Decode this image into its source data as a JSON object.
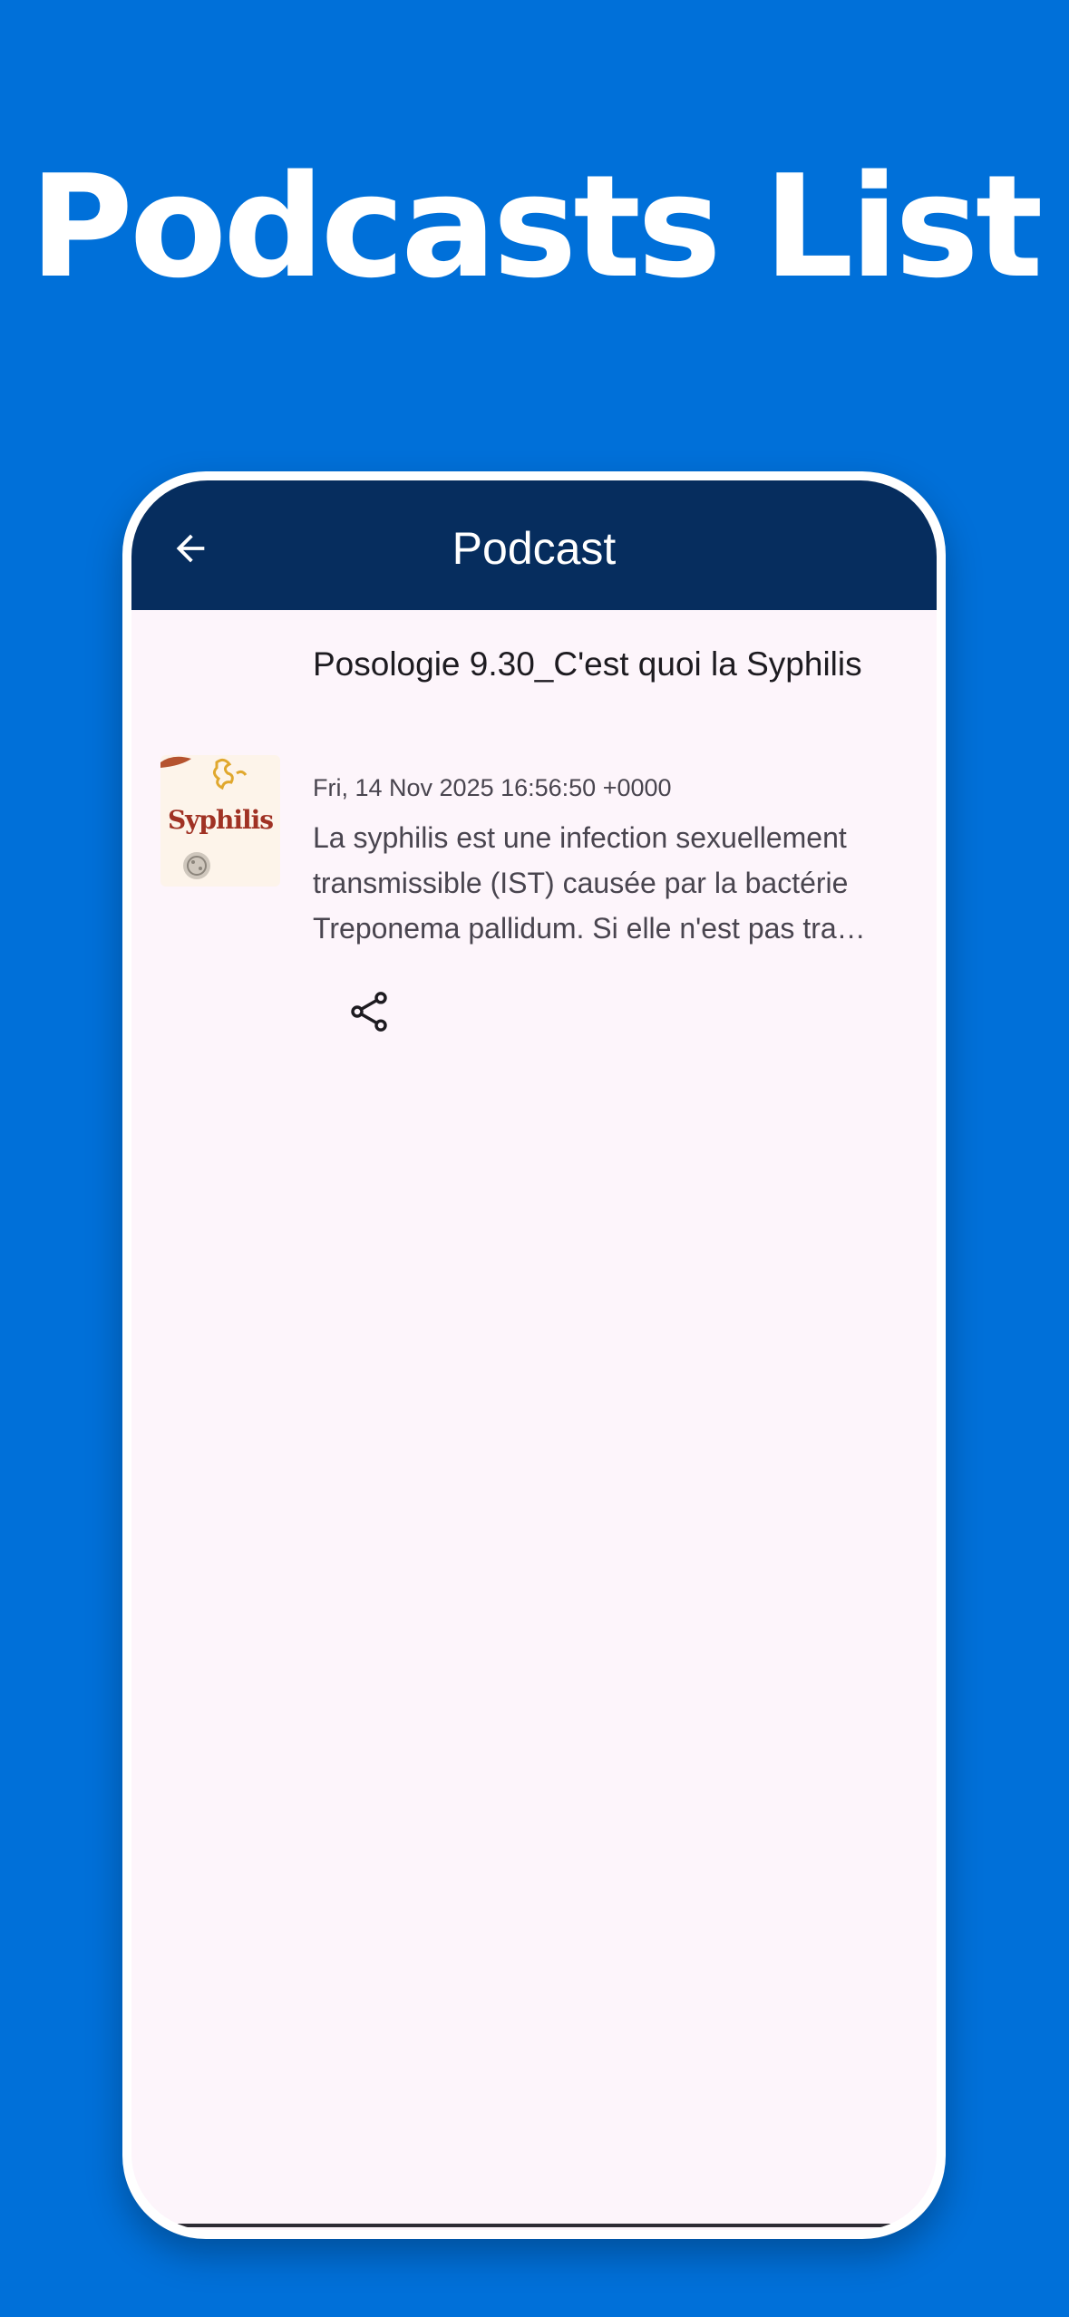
{
  "promo": {
    "headline": "Podcasts List"
  },
  "app_bar": {
    "title": "Podcast",
    "back_icon": "arrow-back-icon"
  },
  "episodes": [
    {
      "title": "Posologie 9.30_C'est quoi la Syphilis",
      "date": "Fri, 14 Nov 2025 16:56:50 +0000",
      "description": "La syphilis est une infection sexuellement transmissible (IST) causée par la bactérie Treponema pallidum. Si elle n'est pas tra…",
      "thumbnail_text": "Syphilis",
      "share_icon": "share-icon"
    }
  ],
  "colors": {
    "background": "#0070d9",
    "app_bar": "#062d5e",
    "screen": "#fdf5fb",
    "thumbnail_text": "#a03224"
  }
}
